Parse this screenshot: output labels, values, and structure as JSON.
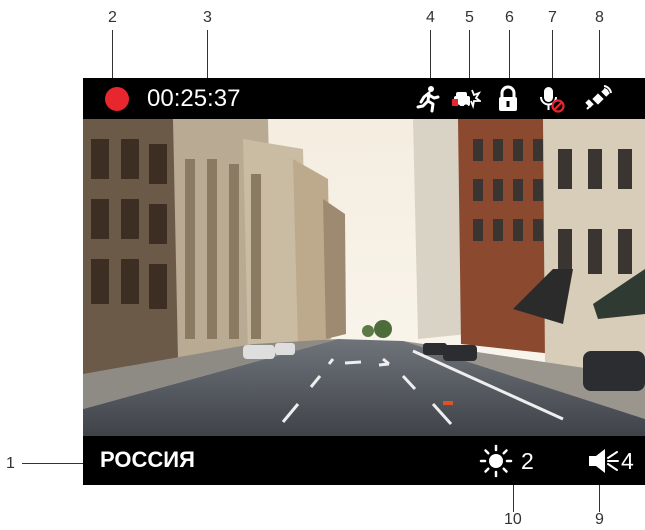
{
  "callouts": {
    "c1": "1",
    "c2": "2",
    "c3": "3",
    "c4": "4",
    "c5": "5",
    "c6": "6",
    "c7": "7",
    "c8": "8",
    "c9": "9",
    "c10": "10"
  },
  "status_bar": {
    "recording_indicator_color": "#e8262d",
    "recording_time": "00:25:37",
    "icons": [
      "motion-detection-icon",
      "parking-mode-icon",
      "lock-icon",
      "microphone-off-icon",
      "gps-icon"
    ]
  },
  "info_bar": {
    "region": "РОССИЯ",
    "brightness_icon": "sun-icon",
    "brightness_level": "2",
    "volume_icon": "speaker-icon",
    "volume_level": "4"
  },
  "video_feed": {
    "scene": "city-street-icon"
  }
}
